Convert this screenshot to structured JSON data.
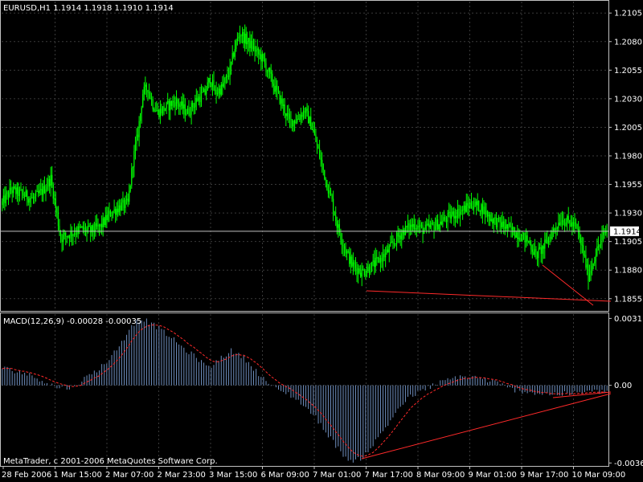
{
  "window": {
    "symbol_header": "EURUSD,H1  1.1914 1.1918 1.1910 1.1914",
    "current_price": "1.1914",
    "copyright": "MetaTrader, c 2001-2006 MetaQuotes Software Corp."
  },
  "colors": {
    "background": "#000000",
    "grid": "#3a3a3a",
    "candle": "#00ff00",
    "macd_histogram": "#6f8fbf",
    "signal_line": "#ff2a2a",
    "trendline": "#ff2a2a",
    "price_line": "#c0c0c0"
  },
  "price_panel": {
    "y_ticks": [
      "1.2105",
      "1.2080",
      "1.2055",
      "1.2030",
      "1.2005",
      "1.1980",
      "1.1955",
      "1.1930",
      "1.1905",
      "1.1880",
      "1.1855"
    ],
    "y_range": [
      1.1845,
      1.2115
    ],
    "last_price": 1.1914
  },
  "macd_panel": {
    "label": "MACD(12,26,9) -0.00028 -0.00035",
    "y_ticks": [
      "0.0031",
      "0.00",
      "-0.0036"
    ],
    "y_range": [
      -0.0037,
      0.0033
    ]
  },
  "x_axis": {
    "labels": [
      "28 Feb 2006",
      "1 Mar 15:00",
      "2 Mar 07:00",
      "2 Mar 23:00",
      "3 Mar 15:00",
      "6 Mar 09:00",
      "7 Mar 01:00",
      "7 Mar 17:00",
      "8 Mar 09:00",
      "9 Mar 01:00",
      "9 Mar 17:00",
      "10 Mar 09:00"
    ]
  },
  "chart_data": {
    "type": "candlestick",
    "price_anchors": [
      [
        0,
        1.1937
      ],
      [
        8,
        1.195
      ],
      [
        18,
        1.1946
      ],
      [
        26,
        1.1942
      ],
      [
        34,
        1.195
      ],
      [
        40,
        1.196
      ],
      [
        44,
        1.1935
      ],
      [
        48,
        1.1908
      ],
      [
        56,
        1.1912
      ],
      [
        64,
        1.1916
      ],
      [
        72,
        1.1914
      ],
      [
        80,
        1.1918
      ],
      [
        88,
        1.193
      ],
      [
        96,
        1.1936
      ],
      [
        102,
        1.1938
      ],
      [
        106,
        1.1975
      ],
      [
        110,
        1.2
      ],
      [
        114,
        1.2035
      ],
      [
        118,
        1.204
      ],
      [
        122,
        1.2025
      ],
      [
        126,
        1.2018
      ],
      [
        132,
        1.2022
      ],
      [
        140,
        1.2028
      ],
      [
        150,
        1.2018
      ],
      [
        158,
        1.203
      ],
      [
        164,
        1.2035
      ],
      [
        168,
        1.2048
      ],
      [
        172,
        1.2035
      ],
      [
        178,
        1.204
      ],
      [
        184,
        1.2055
      ],
      [
        188,
        1.2075
      ],
      [
        192,
        1.2088
      ],
      [
        196,
        1.2082
      ],
      [
        200,
        1.2078
      ],
      [
        206,
        1.207
      ],
      [
        210,
        1.2065
      ],
      [
        214,
        1.2055
      ],
      [
        220,
        1.204
      ],
      [
        226,
        1.2025
      ],
      [
        232,
        1.201
      ],
      [
        238,
        1.2012
      ],
      [
        244,
        1.202
      ],
      [
        250,
        1.2005
      ],
      [
        256,
        1.198
      ],
      [
        262,
        1.1955
      ],
      [
        266,
        1.194
      ],
      [
        270,
        1.192
      ],
      [
        276,
        1.19
      ],
      [
        282,
        1.1885
      ],
      [
        290,
        1.1878
      ],
      [
        296,
        1.1882
      ],
      [
        302,
        1.1887
      ],
      [
        310,
        1.1895
      ],
      [
        318,
        1.1908
      ],
      [
        324,
        1.1915
      ],
      [
        332,
        1.192
      ],
      [
        340,
        1.1915
      ],
      [
        346,
        1.1918
      ],
      [
        354,
        1.1922
      ],
      [
        362,
        1.1928
      ],
      [
        370,
        1.1932
      ],
      [
        378,
        1.1938
      ],
      [
        386,
        1.1935
      ],
      [
        394,
        1.1925
      ],
      [
        402,
        1.192
      ],
      [
        410,
        1.1915
      ],
      [
        418,
        1.191
      ],
      [
        424,
        1.1905
      ],
      [
        430,
        1.1893
      ],
      [
        436,
        1.19
      ],
      [
        444,
        1.1915
      ],
      [
        450,
        1.1925
      ],
      [
        456,
        1.1922
      ],
      [
        462,
        1.1918
      ],
      [
        468,
        1.1895
      ],
      [
        472,
        1.1875
      ],
      [
        478,
        1.1895
      ],
      [
        484,
        1.191
      ],
      [
        486,
        1.1914
      ]
    ],
    "macd_anchors": [
      [
        0,
        0.0008
      ],
      [
        16,
        0.0006
      ],
      [
        30,
        0.0003
      ],
      [
        44,
        -0.0001
      ],
      [
        56,
        -0.0001
      ],
      [
        66,
        0.0003
      ],
      [
        76,
        0.0007
      ],
      [
        86,
        0.0012
      ],
      [
        96,
        0.002
      ],
      [
        104,
        0.0028
      ],
      [
        112,
        0.0031
      ],
      [
        122,
        0.0028
      ],
      [
        134,
        0.0023
      ],
      [
        146,
        0.0017
      ],
      [
        158,
        0.0012
      ],
      [
        166,
        0.0008
      ],
      [
        176,
        0.0013
      ],
      [
        184,
        0.0016
      ],
      [
        194,
        0.0013
      ],
      [
        202,
        0.0008
      ],
      [
        210,
        0.0003
      ],
      [
        220,
        -0.0002
      ],
      [
        230,
        -0.0004
      ],
      [
        240,
        -0.0008
      ],
      [
        252,
        -0.0015
      ],
      [
        262,
        -0.0023
      ],
      [
        272,
        -0.0031
      ],
      [
        282,
        -0.0036
      ],
      [
        290,
        -0.0033
      ],
      [
        300,
        -0.0026
      ],
      [
        310,
        -0.0018
      ],
      [
        318,
        -0.0011
      ],
      [
        326,
        -0.0006
      ],
      [
        336,
        -0.0003
      ],
      [
        346,
        0.0
      ],
      [
        356,
        0.0002
      ],
      [
        366,
        0.0004
      ],
      [
        376,
        0.0004
      ],
      [
        386,
        0.0003
      ],
      [
        398,
        0.0001
      ],
      [
        410,
        -0.0002
      ],
      [
        422,
        -0.0003
      ],
      [
        434,
        -0.0004
      ],
      [
        446,
        -0.0004
      ],
      [
        458,
        -0.0004
      ],
      [
        468,
        -0.0003
      ],
      [
        478,
        -0.0003
      ],
      [
        486,
        -0.0003
      ]
    ],
    "bar_count": 487
  }
}
